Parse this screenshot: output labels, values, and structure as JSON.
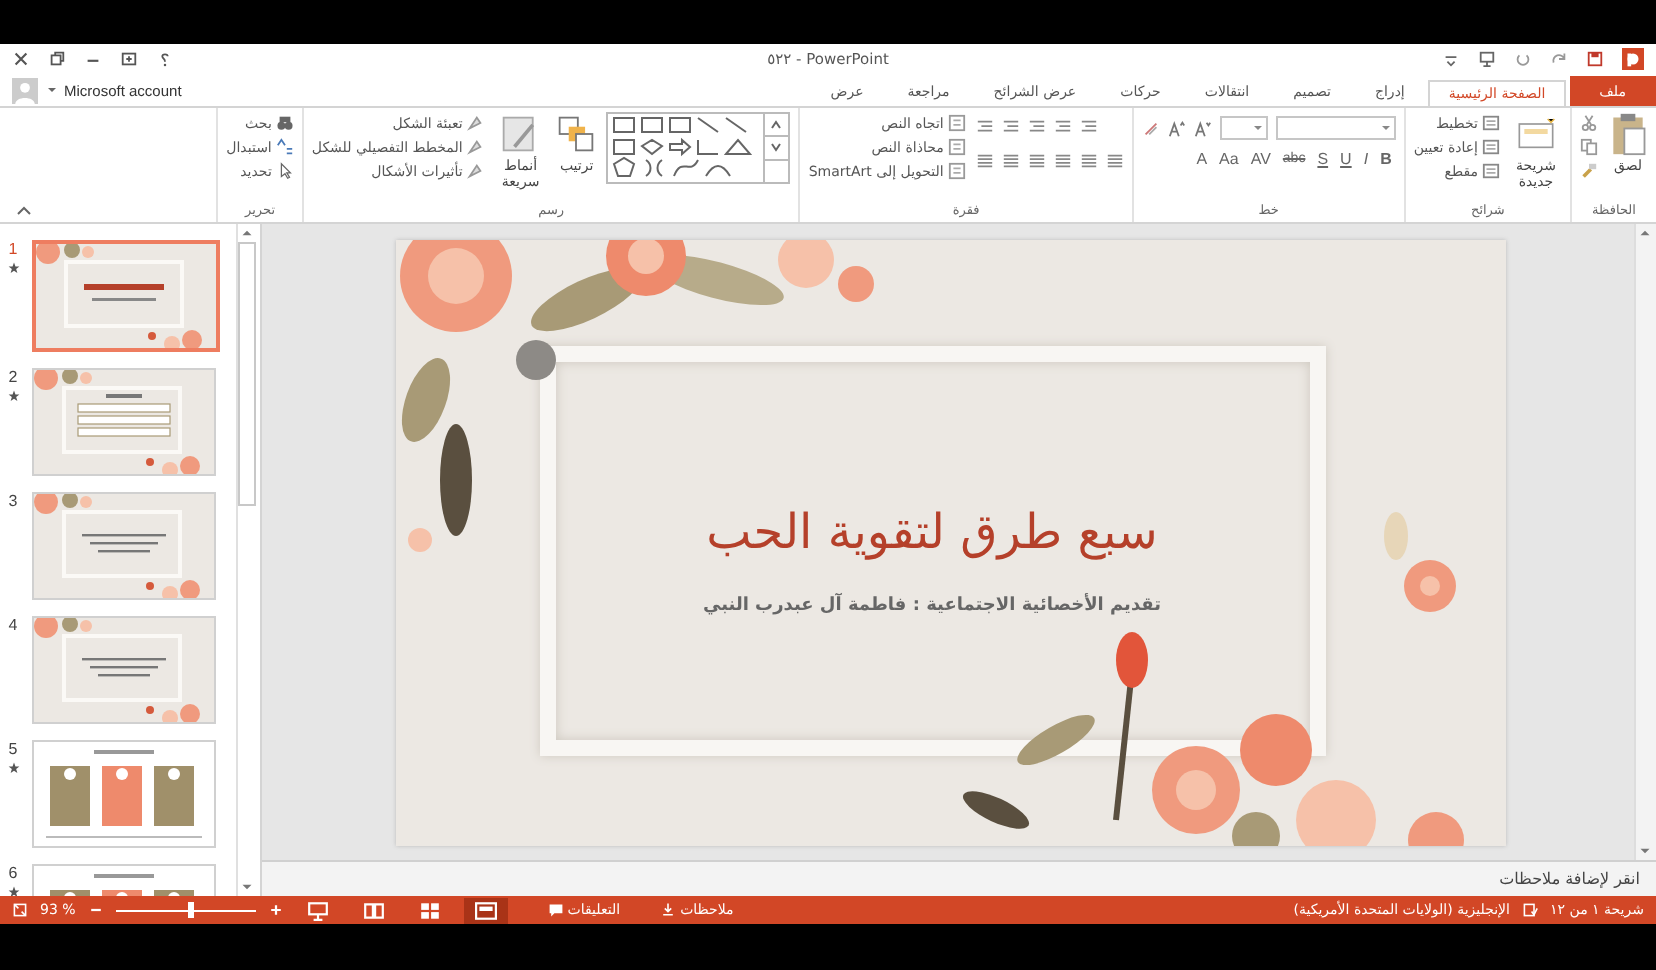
{
  "window": {
    "title": "٥٢٢ - PowerPoint",
    "account": "Microsoft account"
  },
  "tabs": [
    {
      "label": "ملف",
      "kind": "file",
      "selected": false
    },
    {
      "label": "الصفحة الرئيسية",
      "kind": "tab",
      "selected": true
    },
    {
      "label": "إدراج",
      "kind": "tab",
      "selected": false
    },
    {
      "label": "تصميم",
      "kind": "tab",
      "selected": false
    },
    {
      "label": "انتقالات",
      "kind": "tab",
      "selected": false
    },
    {
      "label": "حركات",
      "kind": "tab",
      "selected": false
    },
    {
      "label": "عرض الشرائح",
      "kind": "tab",
      "selected": false
    },
    {
      "label": "مراجعة",
      "kind": "tab",
      "selected": false
    },
    {
      "label": "عرض",
      "kind": "tab",
      "selected": false
    }
  ],
  "ribbon": [
    {
      "label": "الحافظة",
      "kind": "clipboard",
      "items": [
        {
          "label": "لصق"
        }
      ]
    },
    {
      "label": "شرائح",
      "kind": "slides",
      "items": [
        {
          "label": "شريحة جديدة"
        },
        {
          "label": "تخطيط"
        },
        {
          "label": "إعادة تعيين"
        },
        {
          "label": "مقطع"
        }
      ]
    },
    {
      "label": "خط",
      "kind": "font",
      "items": [
        {
          "label": "B"
        },
        {
          "label": "I"
        },
        {
          "label": "U"
        },
        {
          "label": "S"
        },
        {
          "label": "abc"
        },
        {
          "label": "AV"
        },
        {
          "label": "Aa"
        },
        {
          "label": "A"
        }
      ]
    },
    {
      "label": "فقرة",
      "kind": "paragraph",
      "items": [
        {
          "label": "اتجاه النص"
        },
        {
          "label": "محاذاة النص"
        },
        {
          "label": "التحويل إلى SmartArt"
        }
      ]
    },
    {
      "label": "رسم",
      "kind": "drawing",
      "items": [
        {
          "label": "ترتيب"
        },
        {
          "label": "أنماط سريعة"
        },
        {
          "label": "تعبئة الشكل"
        },
        {
          "label": "المخطط التفصيلي للشكل"
        },
        {
          "label": "تأثيرات الأشكال"
        }
      ]
    },
    {
      "label": "تحرير",
      "kind": "editing",
      "items": [
        {
          "label": "بحث"
        },
        {
          "label": "استبدال"
        },
        {
          "label": "تحديد"
        }
      ]
    }
  ],
  "thumbnails": [
    {
      "number": "1",
      "starred": true,
      "selected": true,
      "kind": "title"
    },
    {
      "number": "2",
      "starred": true,
      "selected": false,
      "kind": "list"
    },
    {
      "number": "3",
      "starred": false,
      "selected": false,
      "kind": "text"
    },
    {
      "number": "4",
      "starred": false,
      "selected": false,
      "kind": "text"
    },
    {
      "number": "5",
      "starred": true,
      "selected": false,
      "kind": "boxes"
    },
    {
      "number": "6",
      "starred": true,
      "selected": false,
      "kind": "boxes"
    }
  ],
  "slide": {
    "title": "سبع طرق لتقوية الحب",
    "subtitle": "تقديم الأخصائية الاجتماعية : فاطمة آل عبدرب النبي"
  },
  "notes": {
    "placeholder": "انقر لإضافة ملاحظات"
  },
  "status_bar": {
    "slide_info": "شريحة ١ من ١٢",
    "language": "الإنجليزية (الولايات المتحدة الأمريكية)",
    "notes": "ملاحظات",
    "comments": "التعليقات",
    "zoom": "93 %",
    "zoom_slider": {
      "level": 0.53
    },
    "views": [
      {
        "kind": "slideshow",
        "selected": false
      },
      {
        "kind": "reading",
        "selected": false
      },
      {
        "kind": "sorter",
        "selected": false
      },
      {
        "kind": "normal",
        "selected": true
      }
    ]
  }
}
